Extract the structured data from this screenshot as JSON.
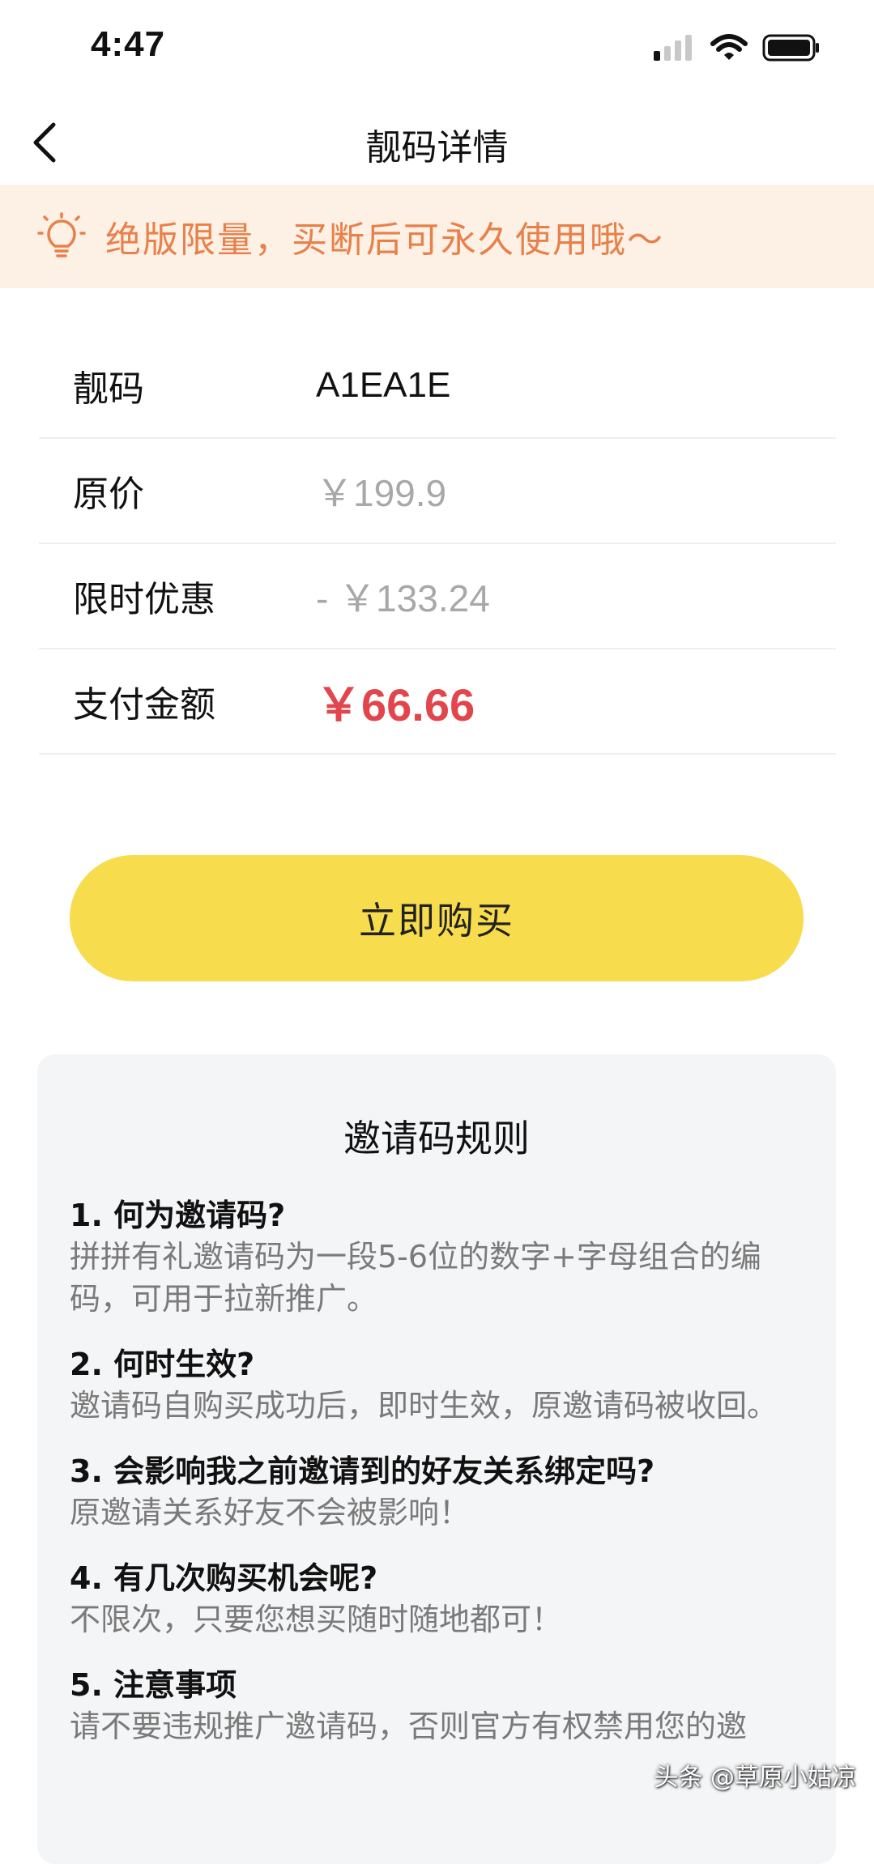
{
  "status_bar": {
    "time": "4:47"
  },
  "nav": {
    "title": "靓码详情"
  },
  "notice": {
    "text": "绝版限量，买断后可永久使用哦～",
    "color": "#e8804a"
  },
  "details": [
    {
      "label": "靓码",
      "value": "A1EA1E"
    },
    {
      "label": "原价",
      "value": "￥199.9"
    },
    {
      "label": "限时优惠",
      "value": "- ￥133.24"
    },
    {
      "label": "支付金额",
      "value": "￥66.66"
    }
  ],
  "buy_button": {
    "label": "立即购买",
    "color": "#f7dc4e"
  },
  "rules": {
    "title": "邀请码规则",
    "items": [
      {
        "q": "1. 何为邀请码?",
        "a": "拼拼有礼邀请码为一段5-6位的数字+字母组合的编码，可用于拉新推广。"
      },
      {
        "q": "2. 何时生效?",
        "a": "邀请码自购买成功后，即时生效，原邀请码被收回。"
      },
      {
        "q": "3. 会影响我之前邀请到的好友关系绑定吗?",
        "a": "原邀请关系好友不会被影响！"
      },
      {
        "q": "4. 有几次购买机会呢?",
        "a": "不限次，只要您想买随时随地都可！"
      },
      {
        "q": "5. 注意事项",
        "a": "请不要违规推广邀请码，否则官方有权禁用您的邀"
      }
    ]
  },
  "watermark": "头条 @草原小姑凉",
  "colors": {
    "accent_red": "#e2464c",
    "price_gray": "#a8a8a8"
  }
}
